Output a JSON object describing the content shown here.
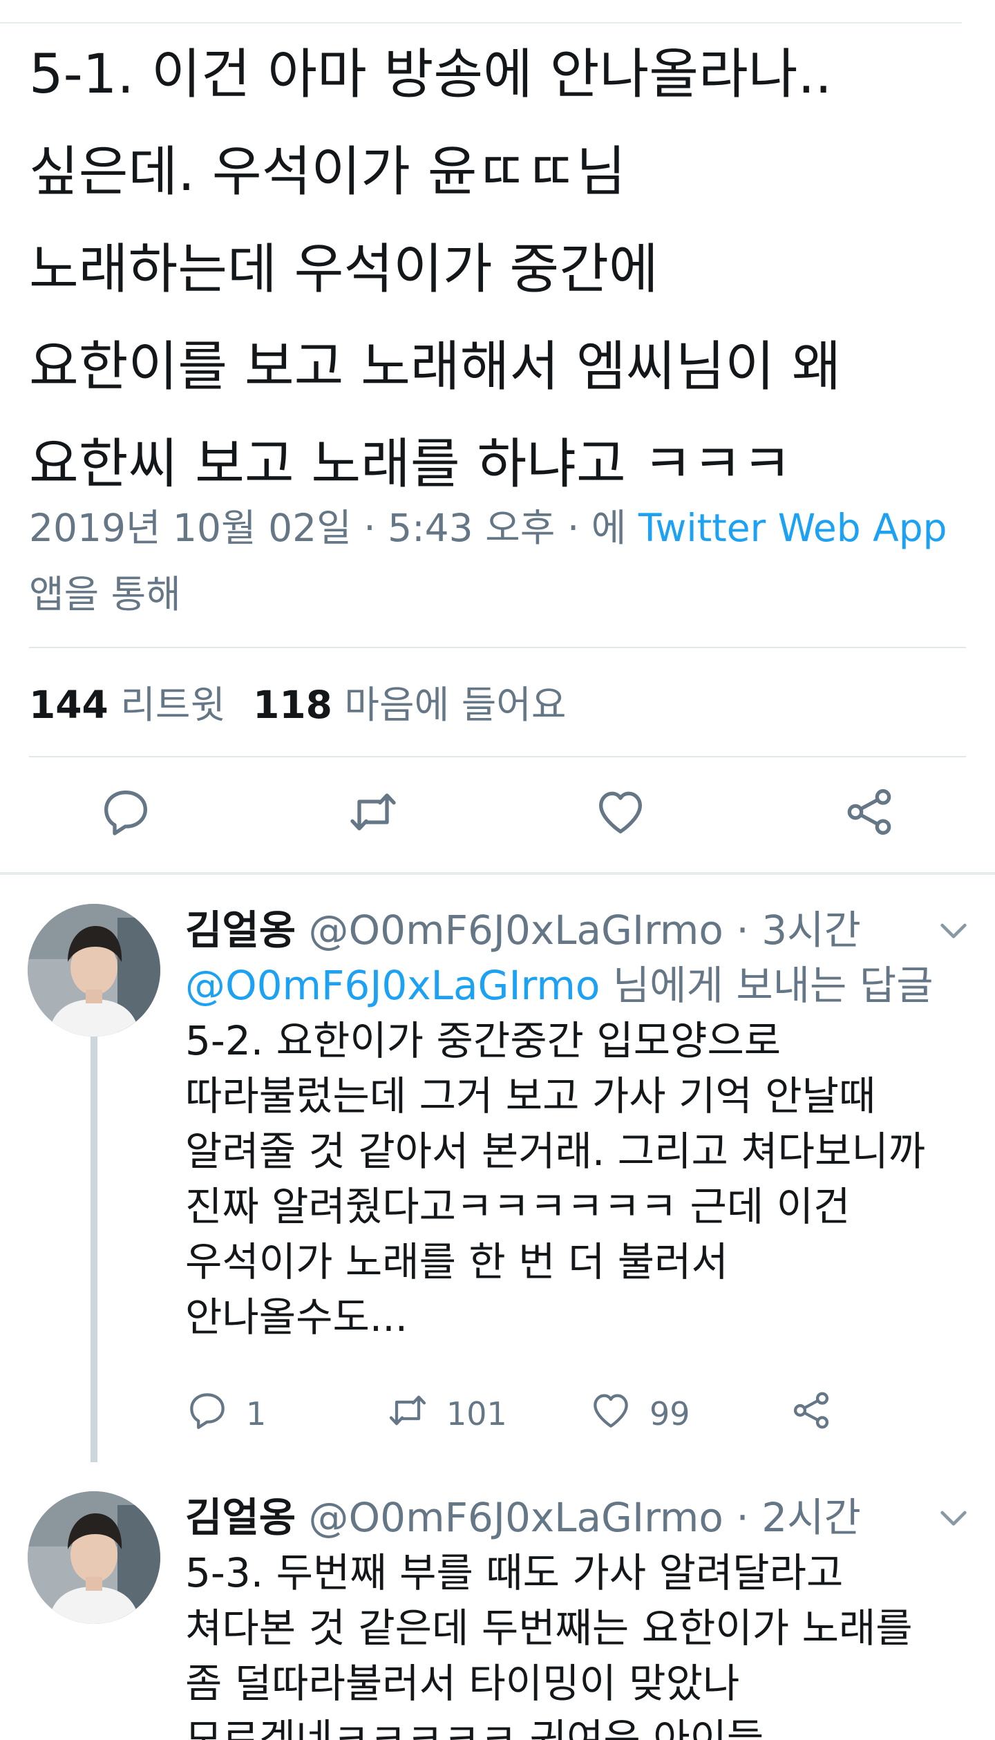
{
  "main_tweet": {
    "lines": [
      "5-1. 이건 아마 방송에 안나올라나..",
      "싶은데. 우석이가 윤ㄸㄸ님",
      "노래하는데 우석이가 중간에",
      "요한이를 보고 노래해서 엠씨님이 왜",
      "요한씨 보고 노래를 하냐고 ㅋㅋㅋ"
    ],
    "timestamp": "2019년 10월 02일 · 5:43 오후 · 에 ",
    "source": "Twitter Web App",
    "source_suffix": "앱을 통해",
    "retweet_count": "144",
    "retweet_label": "리트윗",
    "like_count": "118",
    "like_label": "마음에 들어요"
  },
  "actions": {
    "reply_icon": "reply-icon",
    "retweet_icon": "retweet-icon",
    "like_icon": "heart-icon",
    "share_icon": "share-icon"
  },
  "replies": [
    {
      "name": "김얼옹",
      "handle": "@O0mF6J0xLaGIrmo",
      "time": " · 3시간",
      "reply_to_handle": "@O0mF6J0xLaGIrmo",
      "reply_to_suffix": " 님에게 보내는 답글",
      "lines": [
        "5-2. 요한이가 중간중간 입모양으로",
        "따라불렀는데 그거 보고 가사 기억 안날때",
        "알려줄 것 같아서 본거래. 그리고 쳐다보니까",
        "진짜 알려줬다고ㅋㅋㅋㅋㅋㅋ 근데 이건",
        "우석이가 노래를 한 번 더 불러서",
        "안나올수도..."
      ],
      "reply_count": "1",
      "retweet_count": "101",
      "like_count": "99"
    },
    {
      "name": "김얼옹",
      "handle": "@O0mF6J0xLaGIrmo",
      "time": " · 2시간",
      "lines": [
        "5-3. 두번째 부를 때도 가사 알려달라고",
        "쳐다본 것 같은데 두번째는 요한이가 노래를",
        "좀 덜따라불러서 타이밍이 맞았나",
        "모르겠네ㅋㅋㅋㅋㅋ 귀여운 아이들"
      ]
    }
  ],
  "colors": {
    "text": "#14171a",
    "secondary": "#657786",
    "link": "#1da1f2",
    "divider": "#e1e8ed",
    "thread": "#ccd6dd"
  }
}
